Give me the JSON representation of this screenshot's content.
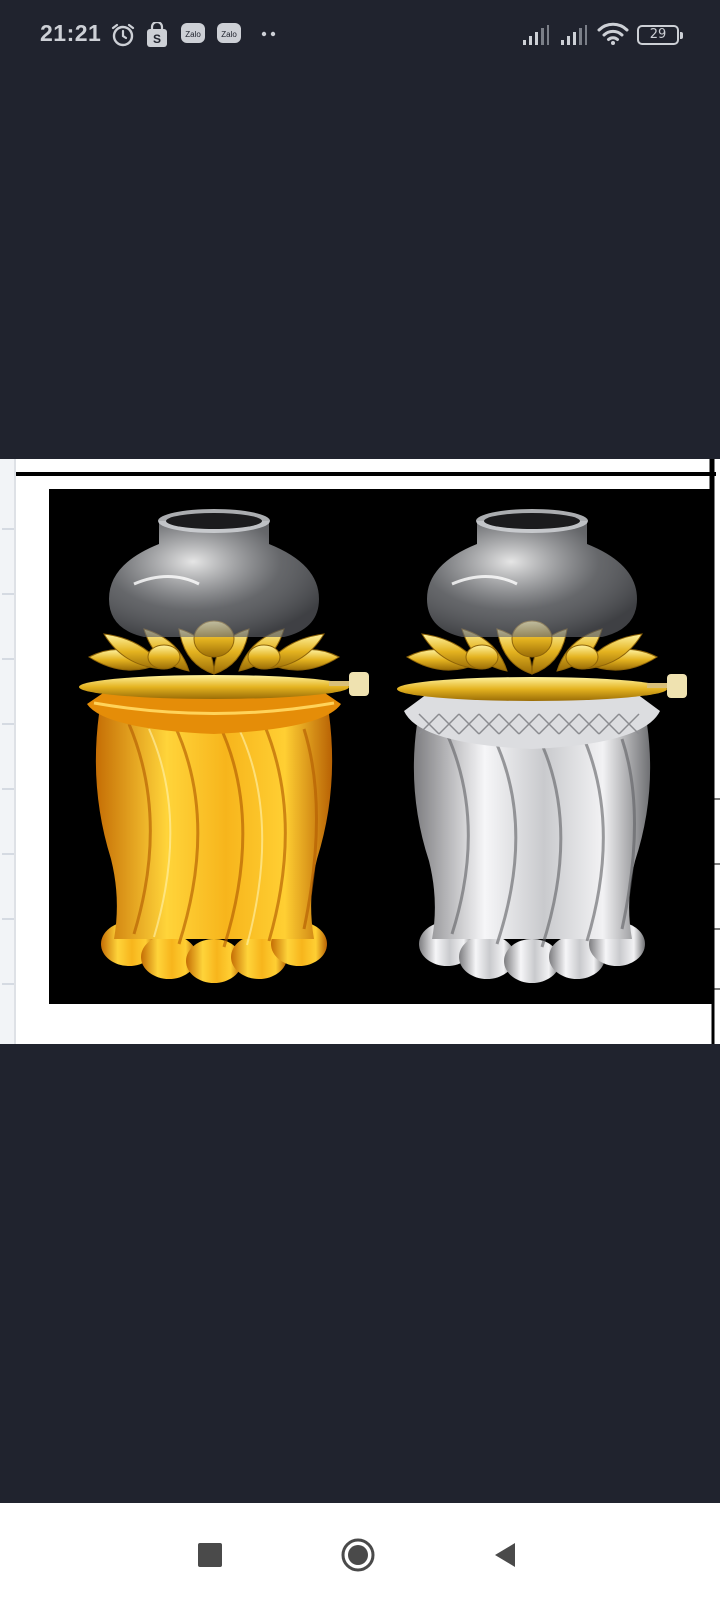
{
  "status_bar": {
    "time": "21:21",
    "notification_icons": [
      "alarm-icon",
      "shopping-bag-icon",
      "zalo-icon",
      "zalo-icon",
      "more-dots-icon"
    ],
    "zalo_label": "Zalo",
    "battery_level": "29"
  },
  "image_viewer": {
    "subject": "two-lotus-oil-lamps",
    "lamps": [
      {
        "name": "amber-lamp",
        "color": "#f2a81d"
      },
      {
        "name": "clear-lamp",
        "color": "#e6e8ea"
      }
    ]
  },
  "nav_bar": {
    "buttons": [
      "recents-icon",
      "home-icon",
      "back-icon"
    ]
  },
  "colors": {
    "background": "#20232e",
    "nav_background": "#ffffff",
    "nav_icon": "#4a4a4a"
  }
}
